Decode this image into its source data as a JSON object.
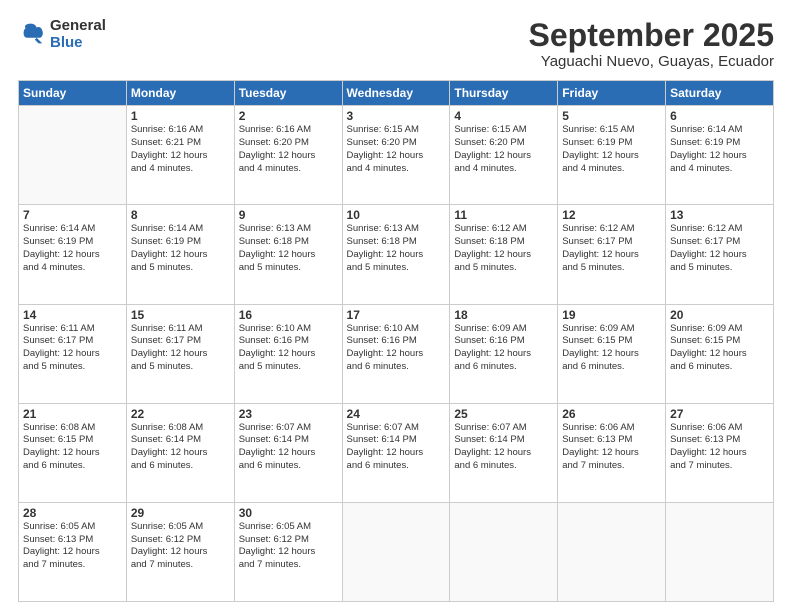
{
  "header": {
    "logo_general": "General",
    "logo_blue": "Blue",
    "title": "September 2025",
    "subtitle": "Yaguachi Nuevo, Guayas, Ecuador"
  },
  "days_of_week": [
    "Sunday",
    "Monday",
    "Tuesday",
    "Wednesday",
    "Thursday",
    "Friday",
    "Saturday"
  ],
  "weeks": [
    [
      {
        "day": null,
        "info": null
      },
      {
        "day": "1",
        "info": "Sunrise: 6:16 AM\nSunset: 6:21 PM\nDaylight: 12 hours\nand 4 minutes."
      },
      {
        "day": "2",
        "info": "Sunrise: 6:16 AM\nSunset: 6:20 PM\nDaylight: 12 hours\nand 4 minutes."
      },
      {
        "day": "3",
        "info": "Sunrise: 6:15 AM\nSunset: 6:20 PM\nDaylight: 12 hours\nand 4 minutes."
      },
      {
        "day": "4",
        "info": "Sunrise: 6:15 AM\nSunset: 6:20 PM\nDaylight: 12 hours\nand 4 minutes."
      },
      {
        "day": "5",
        "info": "Sunrise: 6:15 AM\nSunset: 6:19 PM\nDaylight: 12 hours\nand 4 minutes."
      },
      {
        "day": "6",
        "info": "Sunrise: 6:14 AM\nSunset: 6:19 PM\nDaylight: 12 hours\nand 4 minutes."
      }
    ],
    [
      {
        "day": "7",
        "info": "Sunrise: 6:14 AM\nSunset: 6:19 PM\nDaylight: 12 hours\nand 4 minutes."
      },
      {
        "day": "8",
        "info": "Sunrise: 6:14 AM\nSunset: 6:19 PM\nDaylight: 12 hours\nand 5 minutes."
      },
      {
        "day": "9",
        "info": "Sunrise: 6:13 AM\nSunset: 6:18 PM\nDaylight: 12 hours\nand 5 minutes."
      },
      {
        "day": "10",
        "info": "Sunrise: 6:13 AM\nSunset: 6:18 PM\nDaylight: 12 hours\nand 5 minutes."
      },
      {
        "day": "11",
        "info": "Sunrise: 6:12 AM\nSunset: 6:18 PM\nDaylight: 12 hours\nand 5 minutes."
      },
      {
        "day": "12",
        "info": "Sunrise: 6:12 AM\nSunset: 6:17 PM\nDaylight: 12 hours\nand 5 minutes."
      },
      {
        "day": "13",
        "info": "Sunrise: 6:12 AM\nSunset: 6:17 PM\nDaylight: 12 hours\nand 5 minutes."
      }
    ],
    [
      {
        "day": "14",
        "info": "Sunrise: 6:11 AM\nSunset: 6:17 PM\nDaylight: 12 hours\nand 5 minutes."
      },
      {
        "day": "15",
        "info": "Sunrise: 6:11 AM\nSunset: 6:17 PM\nDaylight: 12 hours\nand 5 minutes."
      },
      {
        "day": "16",
        "info": "Sunrise: 6:10 AM\nSunset: 6:16 PM\nDaylight: 12 hours\nand 5 minutes."
      },
      {
        "day": "17",
        "info": "Sunrise: 6:10 AM\nSunset: 6:16 PM\nDaylight: 12 hours\nand 6 minutes."
      },
      {
        "day": "18",
        "info": "Sunrise: 6:09 AM\nSunset: 6:16 PM\nDaylight: 12 hours\nand 6 minutes."
      },
      {
        "day": "19",
        "info": "Sunrise: 6:09 AM\nSunset: 6:15 PM\nDaylight: 12 hours\nand 6 minutes."
      },
      {
        "day": "20",
        "info": "Sunrise: 6:09 AM\nSunset: 6:15 PM\nDaylight: 12 hours\nand 6 minutes."
      }
    ],
    [
      {
        "day": "21",
        "info": "Sunrise: 6:08 AM\nSunset: 6:15 PM\nDaylight: 12 hours\nand 6 minutes."
      },
      {
        "day": "22",
        "info": "Sunrise: 6:08 AM\nSunset: 6:14 PM\nDaylight: 12 hours\nand 6 minutes."
      },
      {
        "day": "23",
        "info": "Sunrise: 6:07 AM\nSunset: 6:14 PM\nDaylight: 12 hours\nand 6 minutes."
      },
      {
        "day": "24",
        "info": "Sunrise: 6:07 AM\nSunset: 6:14 PM\nDaylight: 12 hours\nand 6 minutes."
      },
      {
        "day": "25",
        "info": "Sunrise: 6:07 AM\nSunset: 6:14 PM\nDaylight: 12 hours\nand 6 minutes."
      },
      {
        "day": "26",
        "info": "Sunrise: 6:06 AM\nSunset: 6:13 PM\nDaylight: 12 hours\nand 7 minutes."
      },
      {
        "day": "27",
        "info": "Sunrise: 6:06 AM\nSunset: 6:13 PM\nDaylight: 12 hours\nand 7 minutes."
      }
    ],
    [
      {
        "day": "28",
        "info": "Sunrise: 6:05 AM\nSunset: 6:13 PM\nDaylight: 12 hours\nand 7 minutes."
      },
      {
        "day": "29",
        "info": "Sunrise: 6:05 AM\nSunset: 6:12 PM\nDaylight: 12 hours\nand 7 minutes."
      },
      {
        "day": "30",
        "info": "Sunrise: 6:05 AM\nSunset: 6:12 PM\nDaylight: 12 hours\nand 7 minutes."
      },
      {
        "day": null,
        "info": null
      },
      {
        "day": null,
        "info": null
      },
      {
        "day": null,
        "info": null
      },
      {
        "day": null,
        "info": null
      }
    ]
  ]
}
